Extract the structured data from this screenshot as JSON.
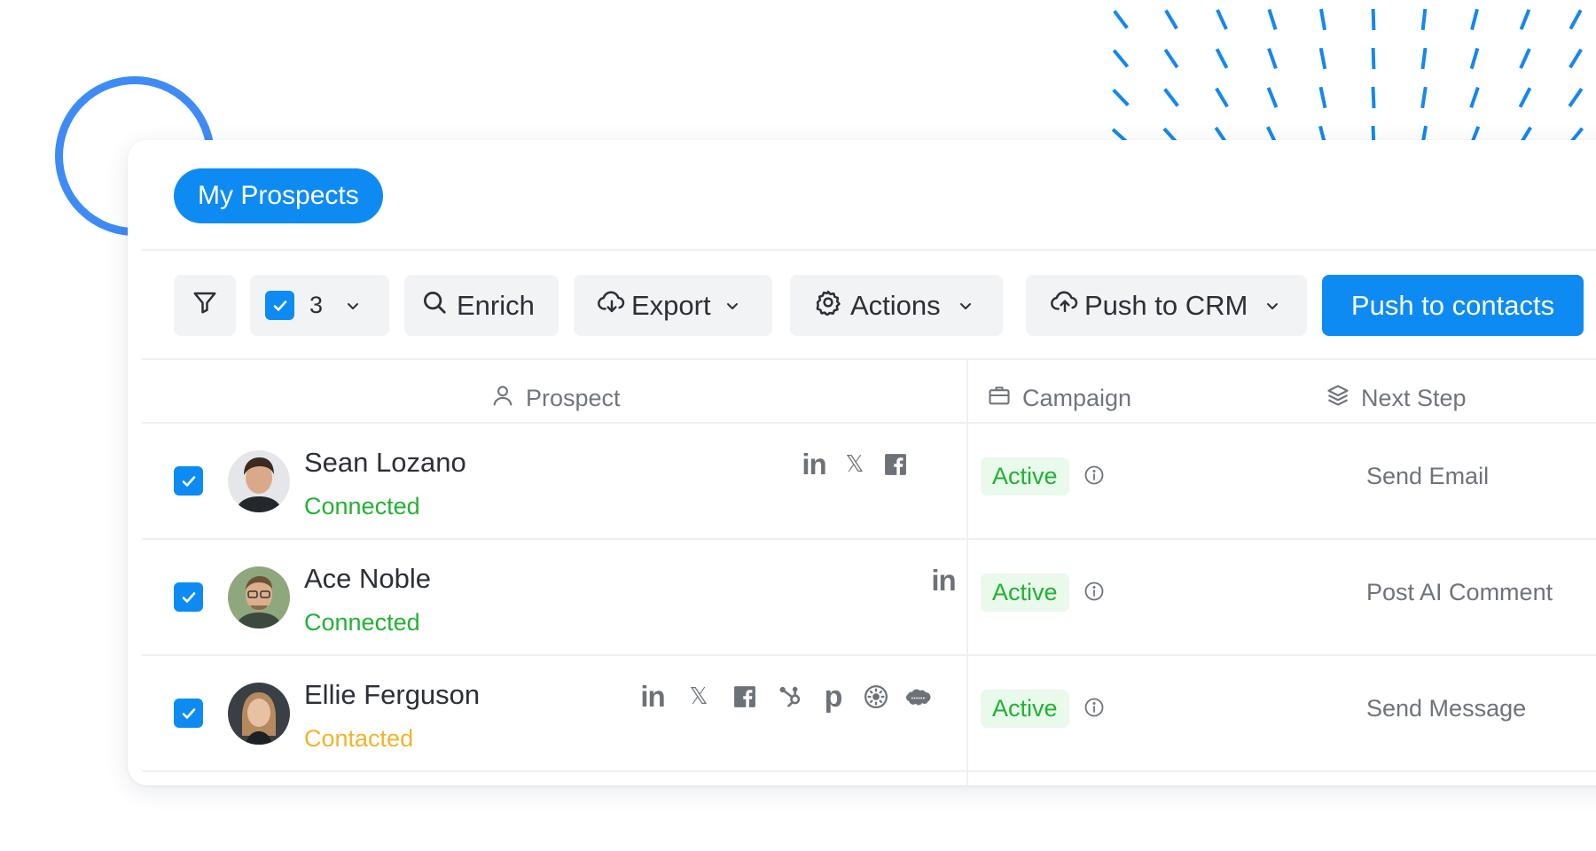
{
  "header": {
    "tab_label": "My Prospects"
  },
  "toolbar": {
    "selected_count": "3",
    "enrich_label": "Enrich",
    "export_label": "Export",
    "actions_label": "Actions",
    "push_crm_label": "Push to CRM",
    "push_contacts_label": "Push to contacts"
  },
  "table": {
    "columns": {
      "prospect": "Prospect",
      "campaign": "Campaign",
      "next_step": "Next Step"
    },
    "rows": [
      {
        "name": "Sean Lozano",
        "status": "Connected",
        "status_color": "#21b233",
        "socials": [
          "linkedin-icon",
          "x-icon",
          "facebook-icon"
        ],
        "campaign_status": "Active",
        "next_step": "Send Email",
        "selected": true
      },
      {
        "name": "Ace Noble",
        "status": "Connected",
        "status_color": "#21b233",
        "socials": [
          "linkedin-icon"
        ],
        "campaign_status": "Active",
        "next_step": "Post AI Comment",
        "selected": true
      },
      {
        "name": "Ellie Ferguson",
        "status": "Contacted",
        "status_color": "#f2b32a",
        "socials": [
          "linkedin-icon",
          "x-icon",
          "facebook-icon",
          "hubspot-icon",
          "pipedrive-icon",
          "zoho-icon",
          "salesforce-icon"
        ],
        "campaign_status": "Active",
        "next_step": "Send Message",
        "selected": true
      }
    ]
  },
  "colors": {
    "accent": "#0d8bf2",
    "active_badge_bg": "#e9f9ec",
    "active_text": "#21b233",
    "contacted": "#f2b32a",
    "ring": "#3f8bf5"
  }
}
